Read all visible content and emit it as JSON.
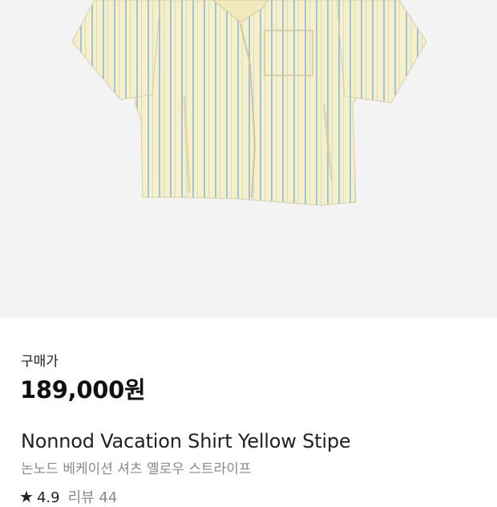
{
  "colors": {
    "image_bg": "#f3f3f3",
    "shirt_base": "#f7efc6",
    "stripe": "#9ec3dd",
    "text_primary": "#222222",
    "text_secondary": "#8a8a8a"
  },
  "product": {
    "image_alt": "yellow striped short-sleeve vacation shirt",
    "price_label": "구매가",
    "price": "189,000원",
    "name_en": "Nonnod Vacation Shirt Yellow Stipe",
    "name_ko": "논노드 베케이션 셔츠 옐로우 스트라이프",
    "rating_icon": "star-icon",
    "rating": "4.9",
    "review_label": "리뷰 44"
  }
}
